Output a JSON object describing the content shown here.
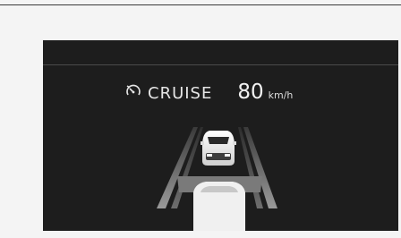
{
  "cruise": {
    "icon": "speedometer-icon",
    "label": "CRUISE",
    "speed": "80",
    "unit": "km/h"
  },
  "colors": {
    "background": "#f4f4f4",
    "screen": "#1d1d1d",
    "text": "#e8e8e8",
    "lane": "#8a8a8a"
  }
}
